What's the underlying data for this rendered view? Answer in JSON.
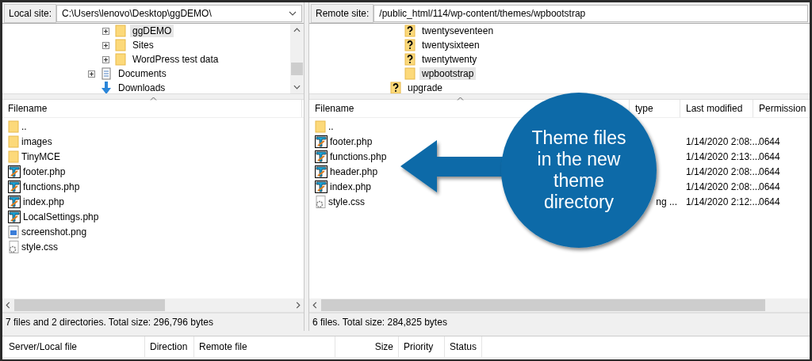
{
  "local": {
    "site_label": "Local site:",
    "path": "C:\\Users\\lenovo\\Desktop\\ggDEMO\\",
    "tree": [
      {
        "children": [
          {
            "label": "ggDEMO",
            "kind": "folder",
            "expandable": true,
            "selected": true
          },
          {
            "label": "Sites",
            "kind": "folder",
            "expandable": true,
            "selected": false
          },
          {
            "label": "WordPress test data",
            "kind": "folder",
            "expandable": true,
            "selected": false
          }
        ]
      },
      {
        "label": "Documents",
        "kind": "documents",
        "expandable": true,
        "selected": false
      },
      {
        "label": "Downloads",
        "kind": "downloads",
        "expandable": false,
        "selected": false
      }
    ],
    "columns": [
      "Filename"
    ],
    "files": [
      {
        "name": "..",
        "kind": "folder"
      },
      {
        "name": "images",
        "kind": "folder"
      },
      {
        "name": "TinyMCE",
        "kind": "folder"
      },
      {
        "name": "footer.php",
        "kind": "php"
      },
      {
        "name": "functions.php",
        "kind": "php"
      },
      {
        "name": "index.php",
        "kind": "php"
      },
      {
        "name": "LocalSettings.php",
        "kind": "php"
      },
      {
        "name": "screenshot.png",
        "kind": "image"
      },
      {
        "name": "style.css",
        "kind": "css"
      }
    ],
    "status": "7 files and 2 directories. Total size: 296,796 bytes"
  },
  "remote": {
    "site_label": "Remote site:",
    "path": "/public_html/114/wp-content/themes/wpbootstrap",
    "tree": [
      {
        "children": [
          {
            "label": "twentyseventeen",
            "kind": "unknown",
            "selected": false
          },
          {
            "label": "twentysixteen",
            "kind": "unknown",
            "selected": false
          },
          {
            "label": "twentytwenty",
            "kind": "unknown",
            "selected": false
          },
          {
            "label": "wpbootstrap",
            "kind": "folder",
            "selected": true
          }
        ]
      },
      {
        "label": "upgrade",
        "kind": "unknown",
        "selected": false
      }
    ],
    "columns": [
      "Filename",
      "type",
      "Last modified",
      "Permission"
    ],
    "files": [
      {
        "name": "..",
        "kind": "folder"
      },
      {
        "name": "footer.php",
        "kind": "php",
        "modified": "1/14/2020 2:08:...",
        "permissions": "0644"
      },
      {
        "name": "functions.php",
        "kind": "php",
        "modified": "1/14/2020 2:13:...",
        "permissions": "0644"
      },
      {
        "name": "header.php",
        "kind": "php",
        "modified": "1/14/2020 2:08:...",
        "permissions": "0644"
      },
      {
        "name": "index.php",
        "kind": "php",
        "modified": "1/14/2020 2:08:...",
        "permissions": "0644"
      },
      {
        "name": "style.css",
        "kind": "css",
        "type": "ng ...",
        "modified": "1/14/2020 2:12:...",
        "permissions": "0644"
      }
    ],
    "status": "6 files. Total size: 284,825 bytes"
  },
  "queue": {
    "columns": [
      "Server/Local file",
      "Direction",
      "Remote file",
      "Size",
      "Priority",
      "Status"
    ]
  },
  "callout": {
    "text": "Theme files in the new theme directory"
  }
}
